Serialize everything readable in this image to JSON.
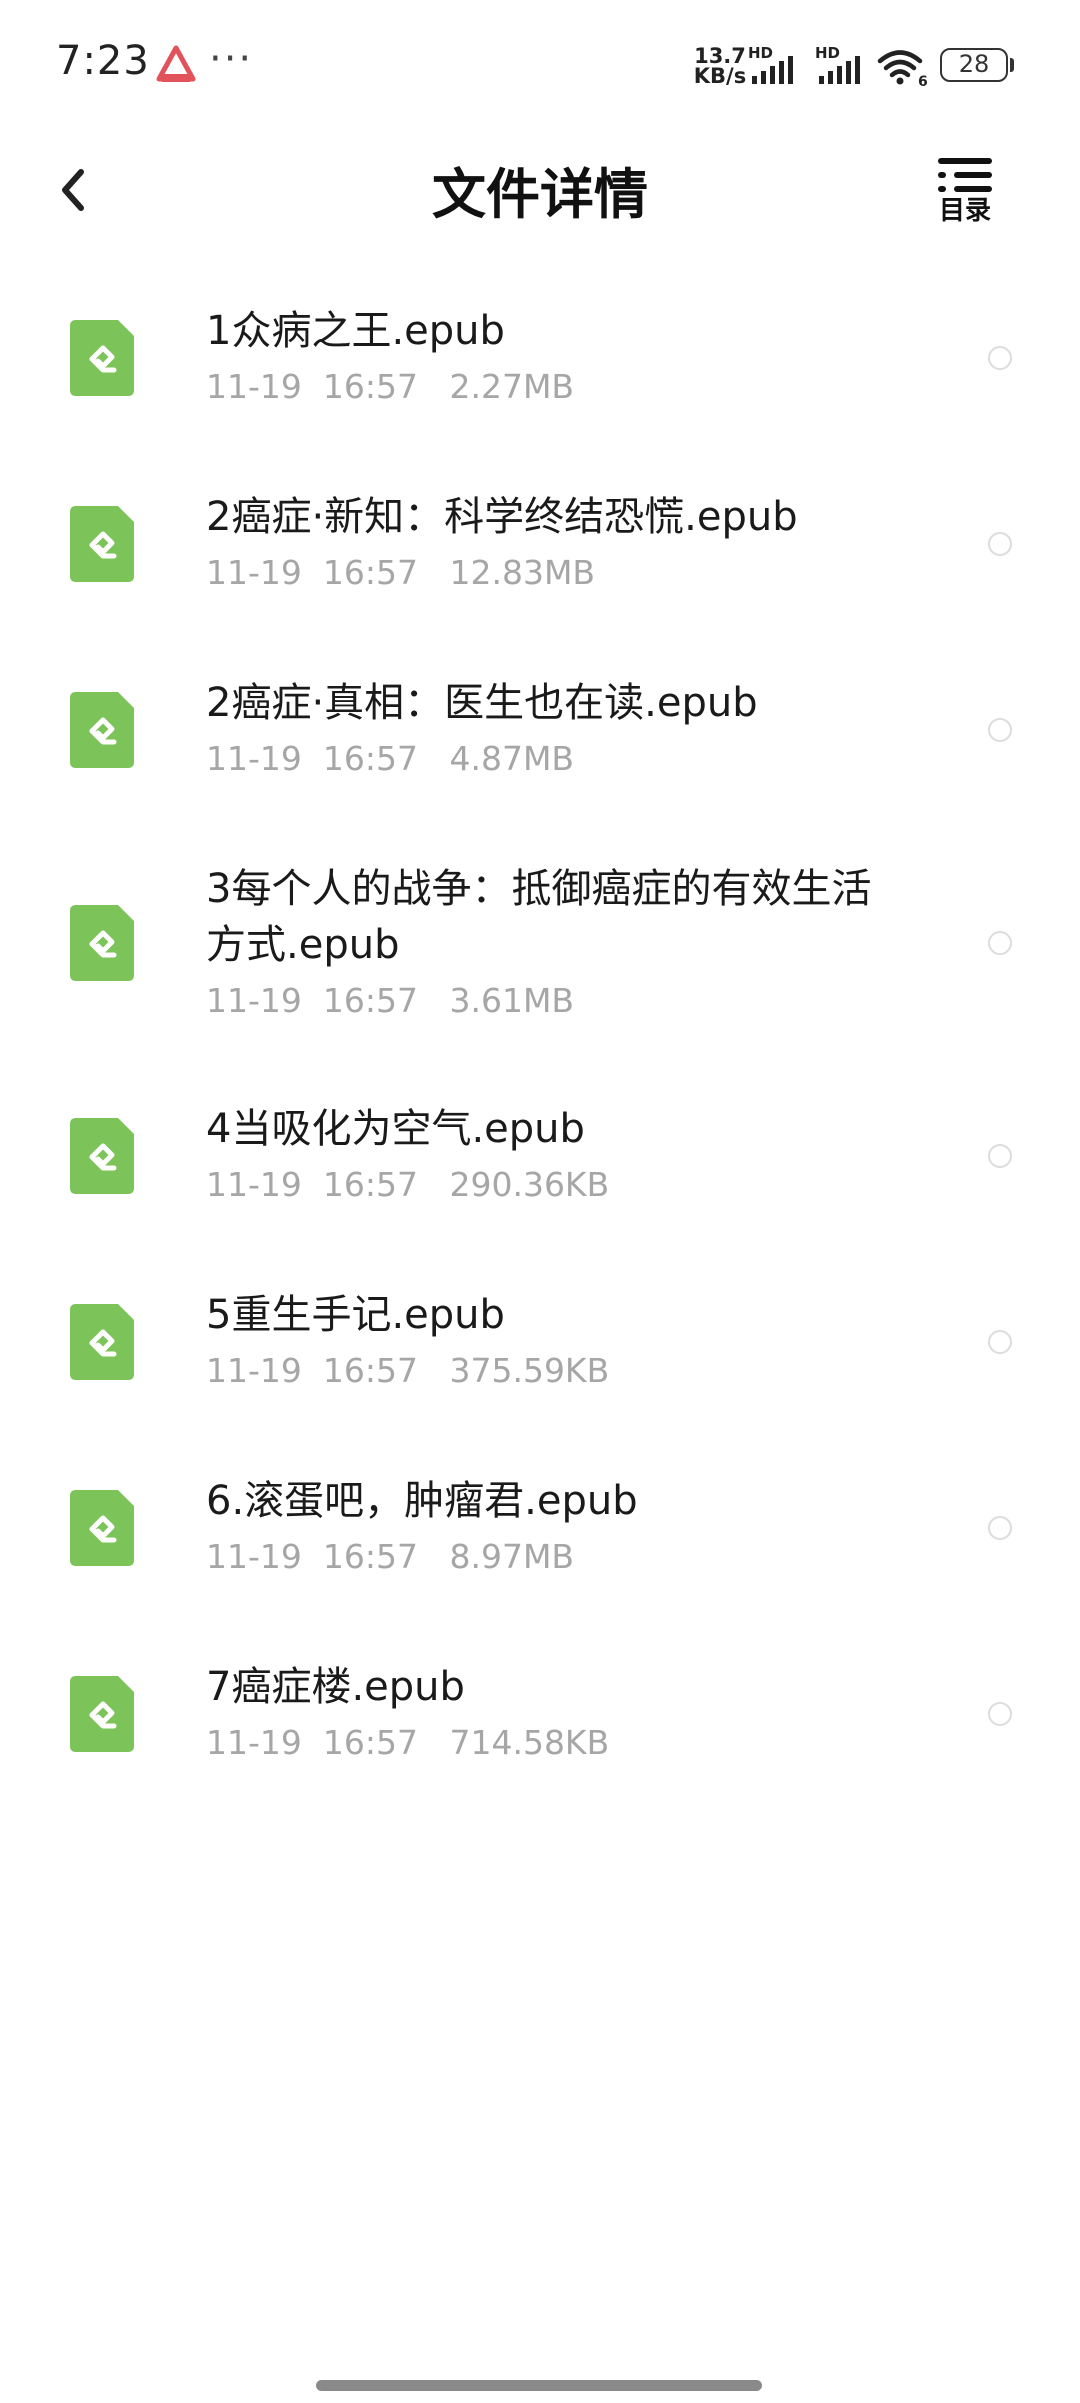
{
  "status_bar": {
    "time": "7:23",
    "more": "···",
    "net_speed_value": "13.7",
    "net_speed_unit": "KB/s",
    "signal_label_1": "HD",
    "signal_label_2": "HD",
    "wifi_badge": "6",
    "battery_level": "28"
  },
  "header": {
    "title": "文件详情",
    "toc_label": "目录"
  },
  "colors": {
    "epub_icon": "#7cc35a",
    "meta_text": "#a6a6a6",
    "radio_border": "#dcdcdc"
  },
  "files": [
    {
      "name": "1众病之王.epub",
      "date": "11-19",
      "time": "16:57",
      "size": "2.27MB"
    },
    {
      "name": "2癌症·新知：科学终结恐慌.epub",
      "date": "11-19",
      "time": "16:57",
      "size": "12.83MB"
    },
    {
      "name": "2癌症·真相：医生也在读.epub",
      "date": "11-19",
      "time": "16:57",
      "size": "4.87MB"
    },
    {
      "name": "3每个人的战争：抵御癌症的有效生活方式.epub",
      "date": "11-19",
      "time": "16:57",
      "size": "3.61MB"
    },
    {
      "name": "4当吸化为空气.epub",
      "date": "11-19",
      "time": "16:57",
      "size": "290.36KB"
    },
    {
      "name": "5重生手记.epub",
      "date": "11-19",
      "time": "16:57",
      "size": "375.59KB"
    },
    {
      "name": "6.滚蛋吧，肿瘤君.epub",
      "date": "11-19",
      "time": "16:57",
      "size": "8.97MB"
    },
    {
      "name": "7癌症楼.epub",
      "date": "11-19",
      "time": "16:57",
      "size": "714.58KB"
    }
  ]
}
